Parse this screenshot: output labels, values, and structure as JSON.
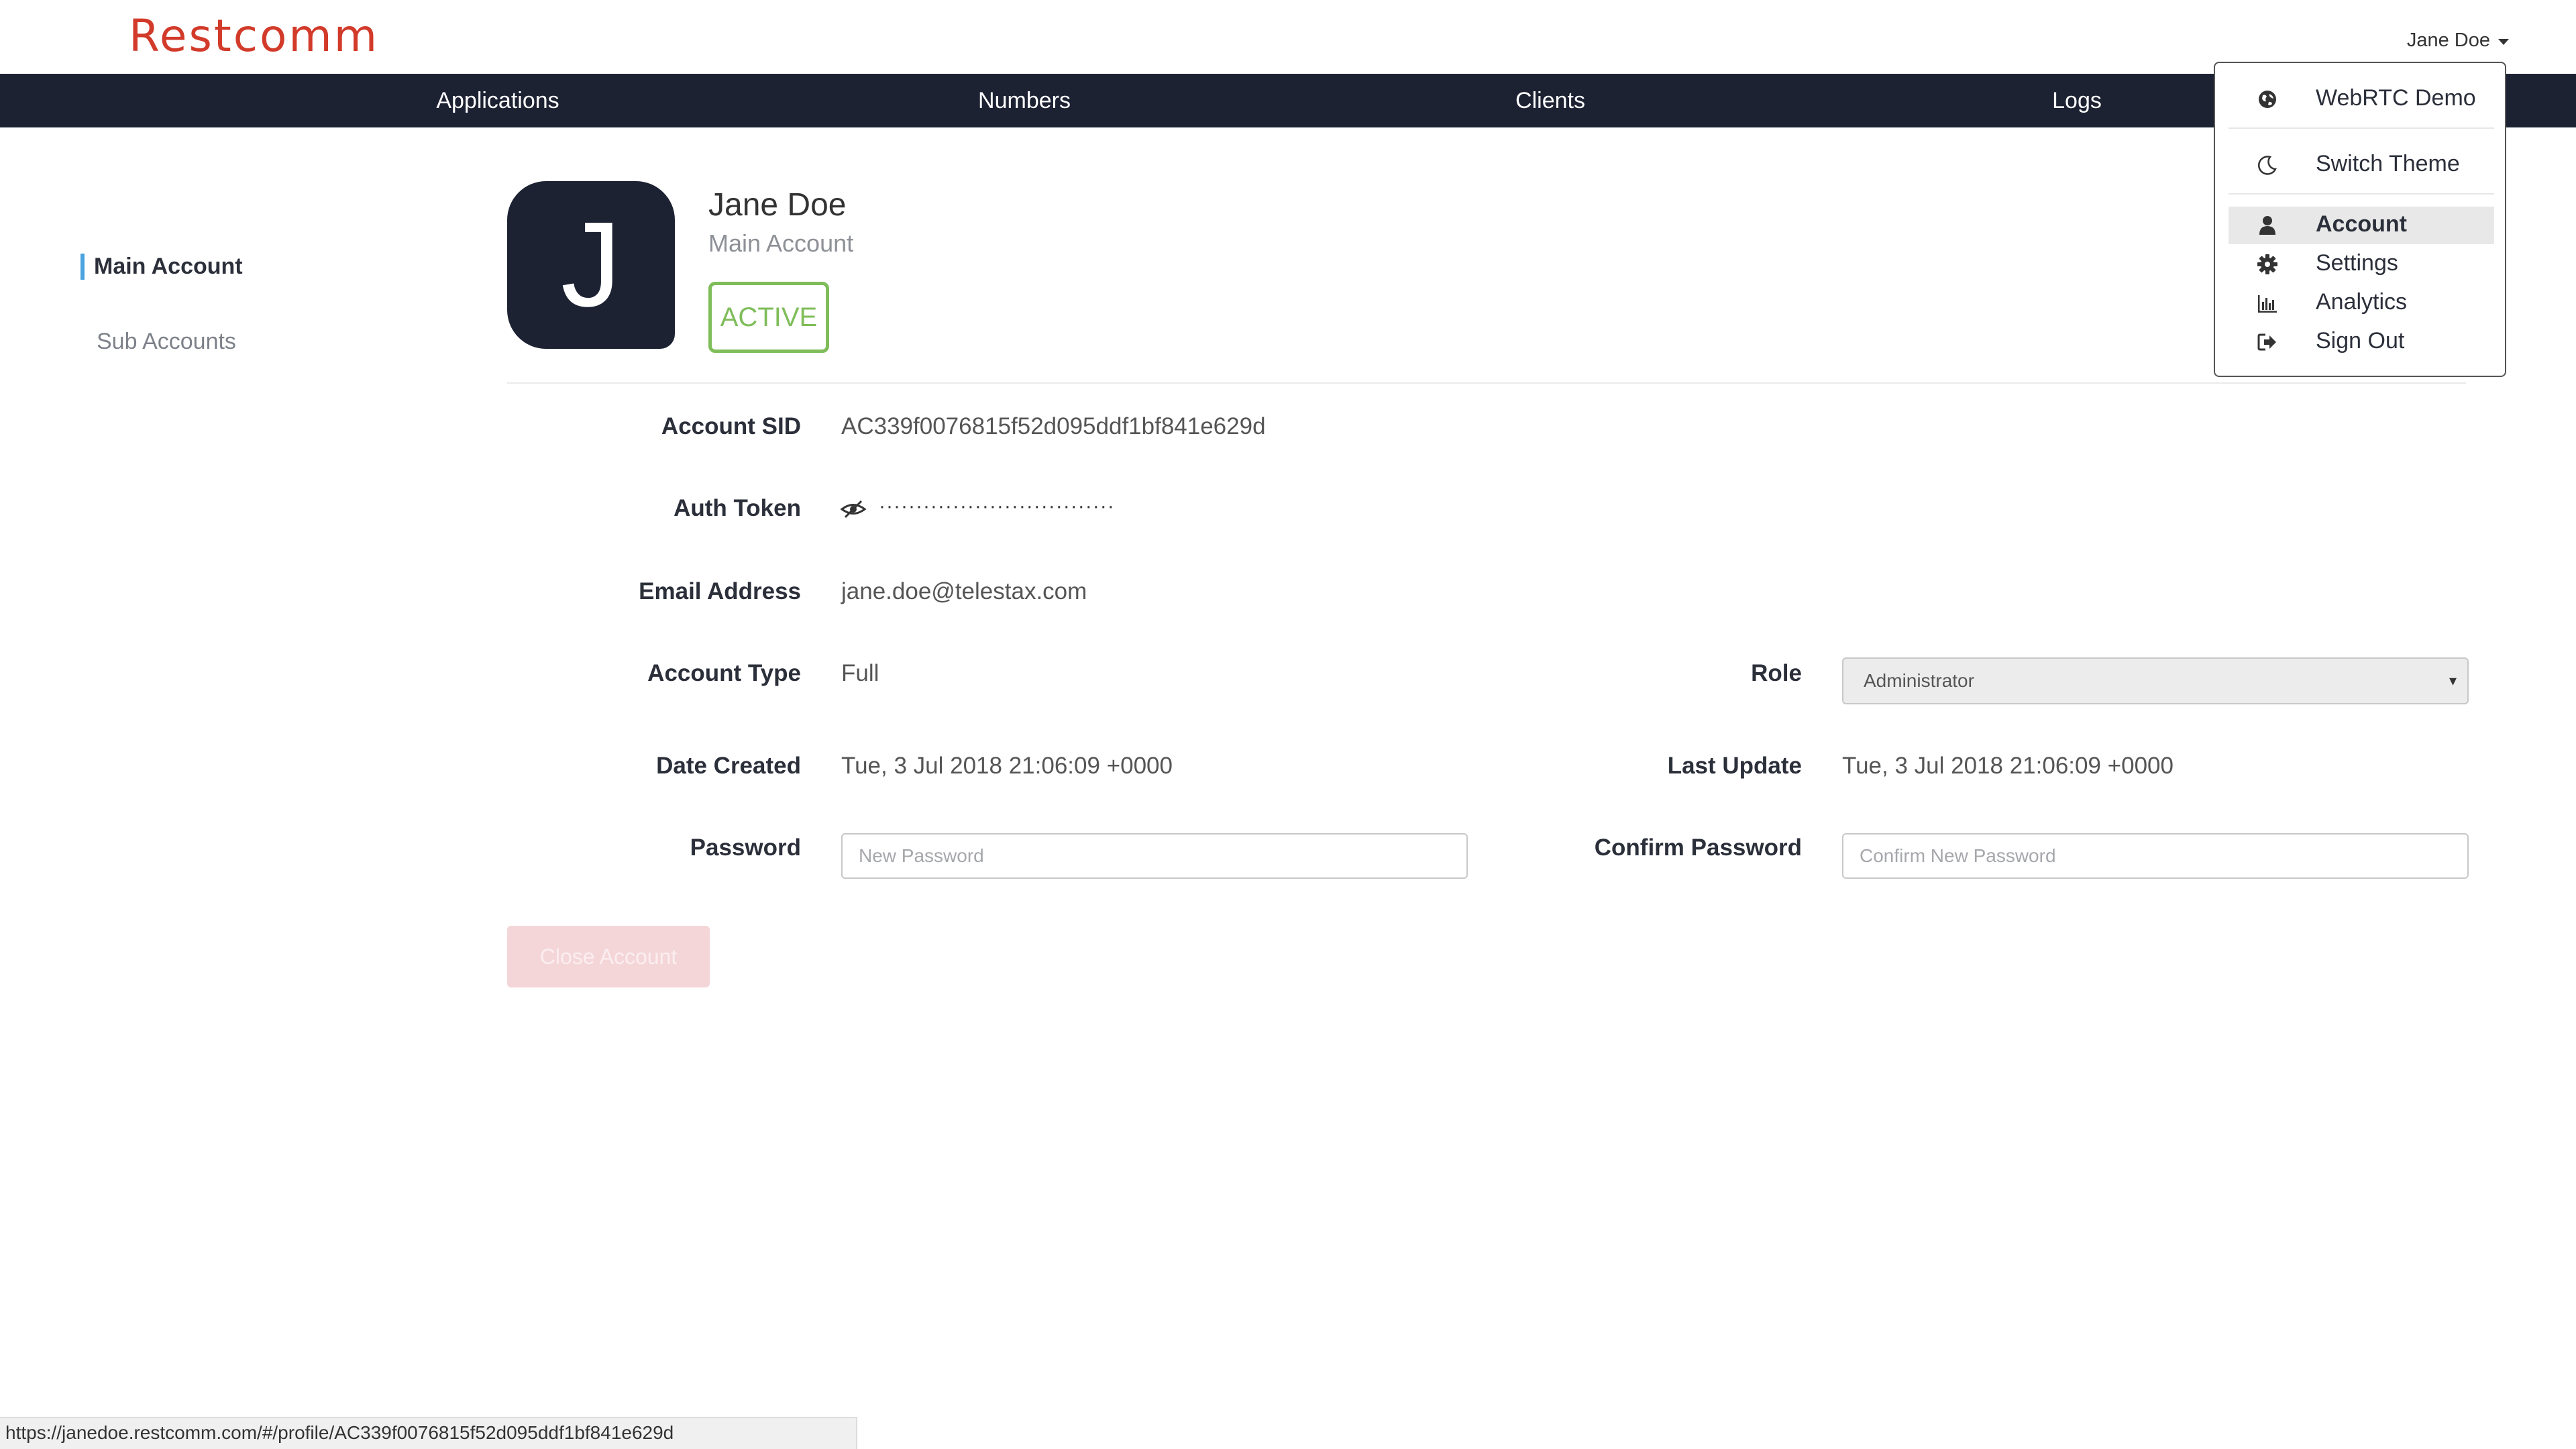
{
  "app": {
    "logo": "Restcomm",
    "user_name": "Jane Doe"
  },
  "nav": {
    "items": [
      "Applications",
      "Numbers",
      "Clients",
      "Logs"
    ]
  },
  "sidebar": {
    "items": [
      {
        "label": "Main Account",
        "active": true
      },
      {
        "label": "Sub Accounts",
        "active": false
      }
    ]
  },
  "profile": {
    "avatar_letter": "J",
    "name": "Jane Doe",
    "subtitle": "Main Account",
    "status": "ACTIVE"
  },
  "details": {
    "account_sid_label": "Account SID",
    "account_sid": "AC339f0076815f52d095ddf1bf841e629d",
    "auth_token_label": "Auth Token",
    "auth_token_masked": "································",
    "email_label": "Email Address",
    "email": "jane.doe@telestax.com",
    "account_type_label": "Account Type",
    "account_type": "Full",
    "role_label": "Role",
    "role": "Administrator",
    "date_created_label": "Date Created",
    "date_created": "Tue, 3 Jul 2018 21:06:09 +0000",
    "last_update_label": "Last Update",
    "last_update": "Tue, 3 Jul 2018 21:06:09 +0000",
    "password_label": "Password",
    "password_placeholder": "New Password",
    "confirm_password_label": "Confirm Password",
    "confirm_password_placeholder": "Confirm New Password",
    "close_account_label": "Close Account"
  },
  "dropdown": {
    "items": [
      {
        "label": "WebRTC Demo",
        "icon": "globe-icon"
      },
      {
        "label": "Switch Theme",
        "icon": "moon-icon"
      },
      {
        "label": "Account",
        "icon": "user-icon",
        "active": true
      },
      {
        "label": "Settings",
        "icon": "gear-icon"
      },
      {
        "label": "Analytics",
        "icon": "bar-chart-icon"
      },
      {
        "label": "Sign Out",
        "icon": "sign-out-icon"
      }
    ]
  },
  "statusbar": {
    "url": "https://janedoe.restcomm.com/#/profile/AC339f0076815f52d095ddf1bf841e629d"
  },
  "colors": {
    "brand": "#d23a2a",
    "navbar": "#1d2233",
    "active_accent": "#4aa3df",
    "status_active": "#7fbd5a",
    "close_button": "#f4d6d8"
  }
}
